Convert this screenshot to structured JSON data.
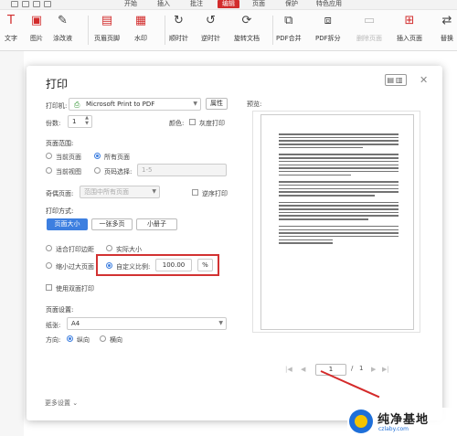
{
  "menubar": {
    "items": [
      "开始",
      "插入",
      "批注",
      "编辑",
      "页面",
      "保护",
      "特色应用"
    ],
    "active": "编辑",
    "accent": "#d22c2c"
  },
  "ribbon": {
    "tools": [
      {
        "label": "文字",
        "icon": "text-cursor-icon"
      },
      {
        "label": "图片",
        "icon": "image-icon"
      },
      {
        "label": "涂改液",
        "icon": "pen-icon"
      },
      {
        "label": "页眉页脚",
        "icon": "header-footer-icon"
      },
      {
        "label": "水印",
        "icon": "watermark-icon"
      },
      {
        "label": "顺时针",
        "icon": "rotate-cw-icon"
      },
      {
        "label": "逆时针",
        "icon": "rotate-ccw-icon"
      },
      {
        "label": "旋转文档",
        "icon": "rotate-doc-icon"
      },
      {
        "label": "PDF合并",
        "icon": "pdf-merge-icon"
      },
      {
        "label": "PDF拆分",
        "icon": "pdf-split-icon"
      },
      {
        "label": "删除页面",
        "icon": "delete-page-icon"
      },
      {
        "label": "插入页面",
        "icon": "insert-page-icon"
      },
      {
        "label": "替换",
        "icon": "replace-icon"
      }
    ]
  },
  "dialog": {
    "title": "打印",
    "printer": {
      "label": "打印机:",
      "value": "Microsoft Print to PDF",
      "properties": "属性"
    },
    "copies": {
      "label": "份数:",
      "value": "1"
    },
    "color": {
      "label": "颜色:",
      "grayscale": "灰度打印"
    },
    "page_range": {
      "section": "页面范围:",
      "current_page": "当前页面",
      "all_pages": "所有页面",
      "current_view": "当前视图",
      "page_select": "页码选择:",
      "page_select_placeholder": "1-5"
    },
    "odd_even": {
      "label": "奇偶页面:",
      "value": "范围中所有页面",
      "reverse": "逆序打印"
    },
    "print_mode": {
      "section": "打印方式:",
      "buttons": [
        "页面大小",
        "一张多页",
        "小册子"
      ],
      "fit_area": "适合打印边距",
      "actual_size": "实际大小",
      "shrink_large": "缩小过大页面",
      "custom_scale": "自定义比例:",
      "scale_value": "100.00",
      "scale_unit": "%",
      "duplex": "使用双面打印"
    },
    "page_setup": {
      "section": "页面设置:",
      "paper_label": "纸张:",
      "paper_value": "A4",
      "direction_label": "方向:",
      "portrait": "纵向",
      "landscape": "横向"
    },
    "preview": {
      "label": "预览:"
    },
    "pager": {
      "current": "1",
      "separator": "/",
      "total": "1"
    },
    "more_settings": "更多设置"
  },
  "watermark": {
    "title": "纯净基地",
    "url": "czlaby.com"
  },
  "colors": {
    "accent_blue": "#3d7fe0",
    "highlight_red": "#d23232"
  }
}
